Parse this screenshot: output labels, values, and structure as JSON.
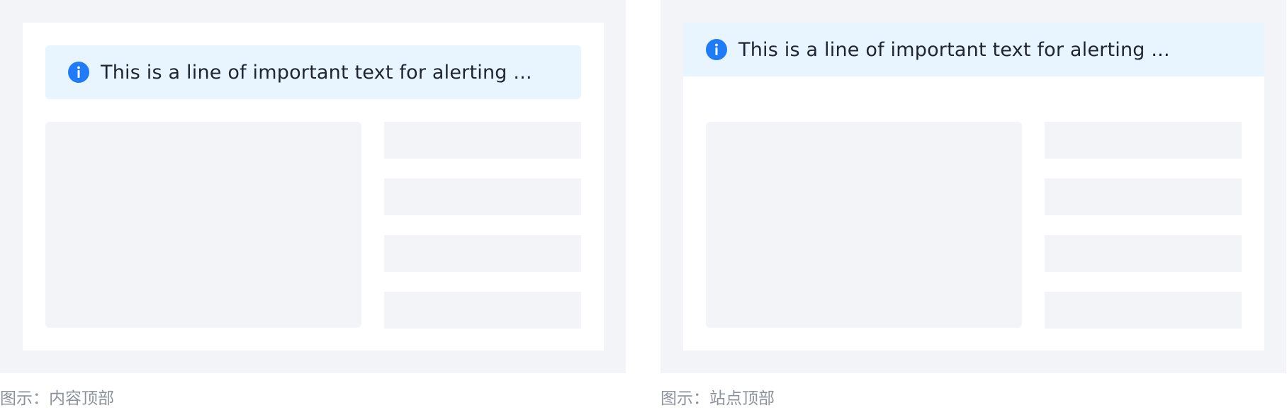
{
  "examples": [
    {
      "alert": {
        "icon": "info-icon",
        "text": "This is a line of important text for alerting ..."
      },
      "caption": "图示：内容顶部"
    },
    {
      "alert": {
        "icon": "info-icon",
        "text": "This is a line of important text for alerting ..."
      },
      "caption": "图示：站点顶部"
    }
  ],
  "colors": {
    "frame_bg": "#f3f4f8",
    "page_bg": "#ffffff",
    "alert_bg": "#e8f4fe",
    "info_icon": "#1f7bf7",
    "alert_text": "#1e2433",
    "caption_text": "#8c919c"
  }
}
